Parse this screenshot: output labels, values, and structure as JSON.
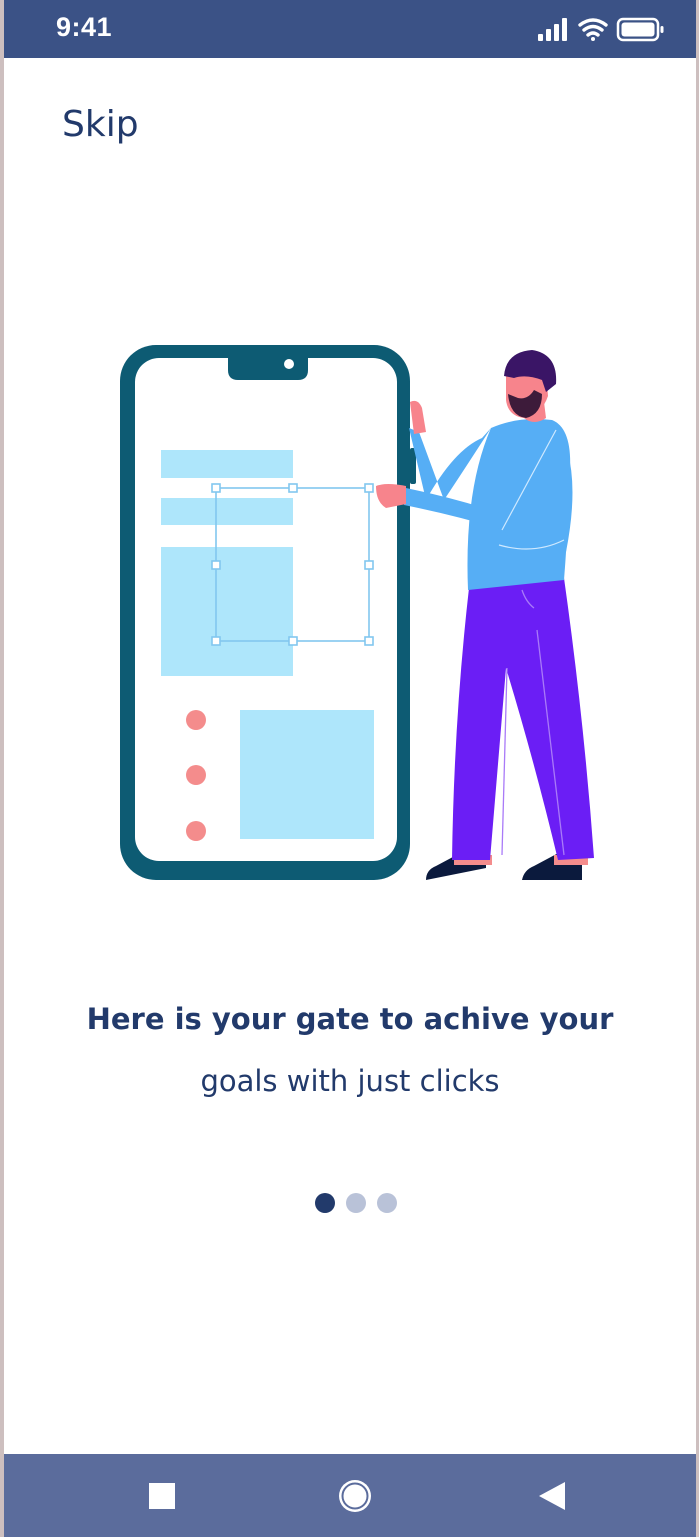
{
  "status_bar": {
    "time": "9:41",
    "icons": [
      "signal-icon",
      "wifi-icon",
      "battery-icon"
    ],
    "color": "#3b5286"
  },
  "header": {
    "skip_label": "Skip"
  },
  "onboarding": {
    "title": "Here is your gate  to achive your",
    "subtitle": "goals with just clicks",
    "page_indicator": {
      "total": 3,
      "active_index": 0
    }
  },
  "nav_bar": {
    "buttons": [
      "recent-apps-icon",
      "home-icon",
      "back-icon"
    ],
    "color": "#5b6c9c"
  },
  "colors": {
    "primary_text": "#223a6b",
    "dot_active": "#223a6b",
    "dot_inactive": "#b9c2d8",
    "phone_frame": "#0d5b73",
    "screen_blocks": "#aee6fb",
    "bullets": "#f48c8c",
    "shirt": "#56aef5",
    "pants": "#6b1ef5"
  }
}
